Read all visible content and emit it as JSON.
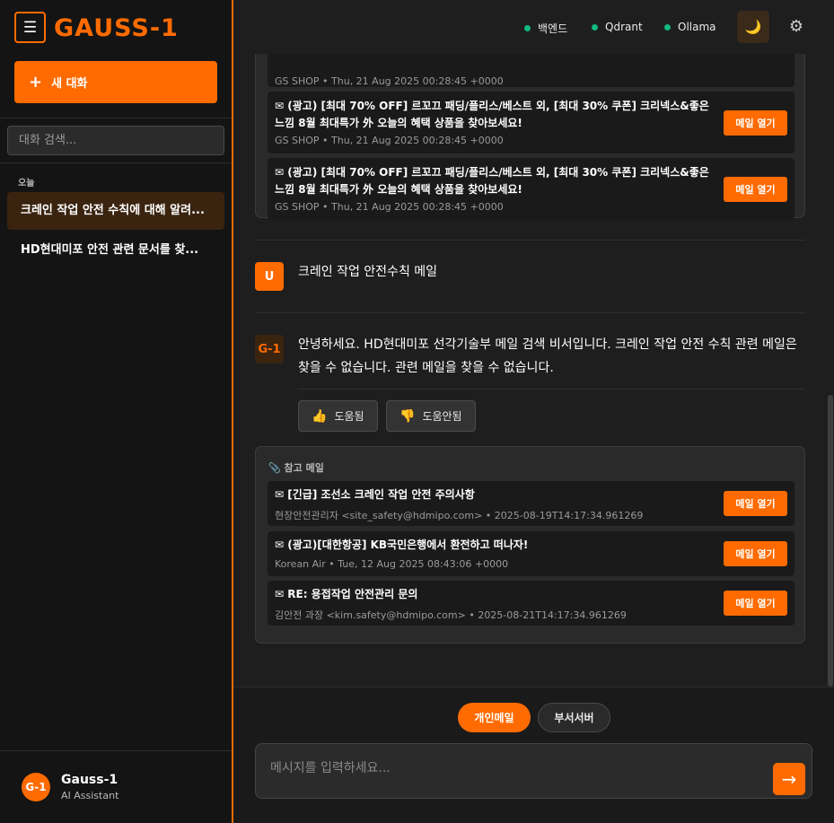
{
  "sidebar": {
    "menu_icon": "☰",
    "logo": "GAUSS-1",
    "new_chat_icon": "+",
    "new_chat_label": "새 대화",
    "search_placeholder": "대화 검색...",
    "section_today": "오늘",
    "conversations": [
      {
        "label": "크레인 작업 안전 수칙에 대해 알려...",
        "active": true
      },
      {
        "label": "HD현대미포 안전 관련 문서를 찾...",
        "active": false
      }
    ],
    "user": {
      "avatar": "G-1",
      "name": "Gauss-1",
      "subtitle": "AI Assistant"
    }
  },
  "header": {
    "statuses": [
      {
        "label": "백엔드",
        "color": "#10b981"
      },
      {
        "label": "Qdrant",
        "color": "#10b981"
      },
      {
        "label": "Ollama",
        "color": "#10b981"
      }
    ],
    "theme_icon": "🌙",
    "settings_icon": "⚙"
  },
  "chat": {
    "prev_mails_partial_meta": "GS SHOP • Thu, 21 Aug 2025 00:28:45 +0000",
    "prev_mails": [
      {
        "icon": "✉",
        "title": "(광고) [최대 70% OFF] 르꼬끄 패딩/플리스/베스트 외, [최대 30% 쿠폰] 크리넥스&좋은느낌 8월 최대특가 外 오늘의 혜택 상품을 찾아보세요!",
        "meta": "GS SHOP • Thu, 21 Aug 2025 00:28:45 +0000",
        "button": "메일 열기"
      },
      {
        "icon": "✉",
        "title": "(광고) [최대 70% OFF] 르꼬끄 패딩/플리스/베스트 외, [최대 30% 쿠폰] 크리넥스&좋은느낌 8월 최대특가 外 오늘의 혜택 상품을 찾아보세요!",
        "meta": "GS SHOP • Thu, 21 Aug 2025 00:28:45 +0000",
        "button": "메일 열기"
      }
    ],
    "user_message": {
      "avatar": "U",
      "text": "크레인 작업 안전수칙 메일"
    },
    "bot_message": {
      "avatar": "G-1",
      "text": "안녕하세요. HD현대미포 선각기술부 메일 검색 비서입니다. 크레인 작업 안전 수칙 관련 메일은 찾을 수 없습니다. 관련 메일을 찾을 수 없습니다.",
      "helpful": {
        "icon": "👍",
        "label": "도움됨"
      },
      "unhelpful": {
        "icon": "👎",
        "label": "도움안됨"
      }
    },
    "references": {
      "icon": "📎",
      "label": "참고 메일",
      "mails": [
        {
          "icon": "✉",
          "title": "[긴급] 조선소 크레인 작업 안전 주의사항",
          "meta": "현장안전관리자 <site_safety@hdmipo.com> • 2025-08-19T14:17:34.961269",
          "button": "메일 열기"
        },
        {
          "icon": "✉",
          "title": "(광고)[대한항공] KB국민은행에서 환전하고 떠나자!",
          "meta": "Korean Air • Tue, 12 Aug 2025 08:43:06 +0000",
          "button": "메일 열기"
        },
        {
          "icon": "✉",
          "title": "RE: 용접작업 안전관리 문의",
          "meta": "김안전 과장 <kim.safety@hdmipo.com> • 2025-08-21T14:17:34.961269",
          "button": "메일 열기"
        }
      ]
    }
  },
  "input": {
    "modes": [
      {
        "label": "개인메일",
        "active": true
      },
      {
        "label": "부서서버",
        "active": false
      }
    ],
    "placeholder": "메시지를 입력하세요...",
    "send_icon": "→"
  },
  "colors": {
    "accent": "#ff6b00",
    "status_ok": "#10b981",
    "background": "#1e1e1e",
    "sidebar": "#141414"
  }
}
